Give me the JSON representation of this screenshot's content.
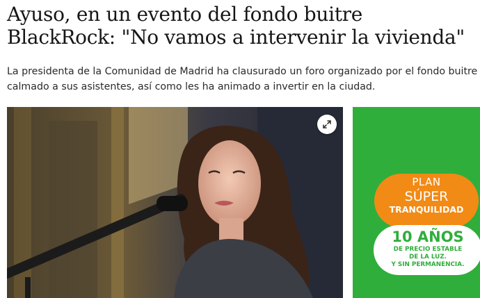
{
  "article": {
    "headline_lines": [
      "Ayuso, en un evento del fondo buitre",
      "BlackRock: \"No vamos a intervenir la vivienda\""
    ],
    "lede_lines": [
      "La presidenta de la Comunidad de Madrid ha clausurado un foro organizado por el fondo buitre y ha",
      "calmado a sus asistentes, así como les ha animado a invertir en la ciudad."
    ]
  },
  "photo": {
    "expand_icon": "expand-icon"
  },
  "ad": {
    "plan": "PLAN",
    "super": "SÚPER",
    "tranquilidad": "TRANQUILIDAD",
    "years": "10 AÑOS",
    "line1": "DE PRECIO ESTABLE",
    "line2": "DE LA LUZ.",
    "line3": "Y SIN PERMANENCIA.",
    "colors": {
      "background": "#2fae3c",
      "orange": "#f28a16",
      "white": "#ffffff"
    }
  }
}
